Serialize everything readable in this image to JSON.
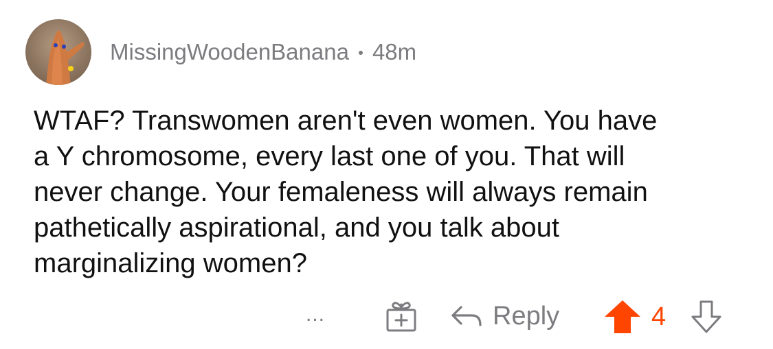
{
  "comment": {
    "username": "MissingWoodenBanana",
    "age": "48m",
    "text": "WTAF? Transwomen aren't even women. You have\na Y chromosome, every last one of you.  That will\nnever change. Your femaleness will always remain\npathetically aspirational, and you talk about\nmarginalizing women?",
    "more_label": "...",
    "reply_label": "Reply",
    "score": "4",
    "upvote_active": true
  },
  "icons": {
    "avatar": "avatar-image",
    "gift": "gift-award-icon",
    "reply": "reply-arrow-icon",
    "upvote": "upvote-arrow-icon",
    "downvote": "downvote-arrow-icon"
  },
  "colors": {
    "muted": "#7c7c80",
    "text": "#111111",
    "upvote_accent": "#ff4500"
  }
}
